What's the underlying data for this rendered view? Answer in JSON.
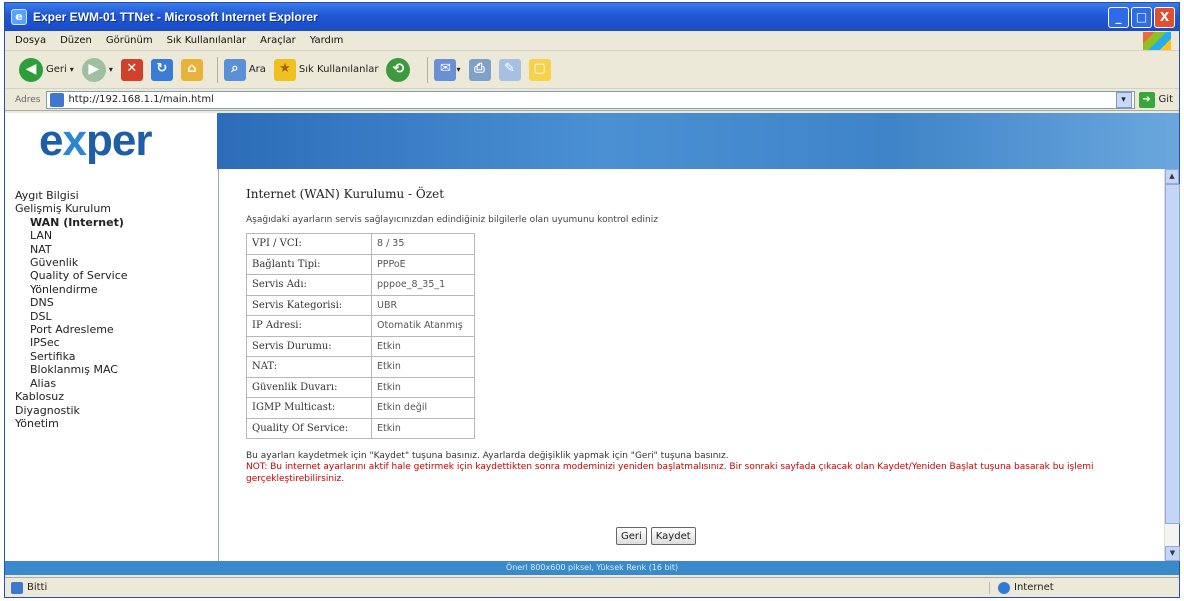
{
  "window": {
    "title": "Exper EWM-01 TTNet - Microsoft Internet Explorer",
    "buttons": [
      "_",
      "□",
      "X"
    ]
  },
  "menu": [
    "Dosya",
    "Düzen",
    "Görünüm",
    "Sık Kullanılanlar",
    "Araçlar",
    "Yardım"
  ],
  "toolbar": {
    "back_label": "Geri",
    "search_label": "Ara",
    "favorites_label": "Sık Kullanılanlar"
  },
  "address": {
    "label": "Adres",
    "url": "http://192.168.1.1/main.html",
    "go_label": "Git"
  },
  "brand": {
    "logo_pre": "e",
    "logo_x": "x",
    "logo_post": "per"
  },
  "sidebar": {
    "items": [
      {
        "label": "Aygıt Bilgisi",
        "level": 1
      },
      {
        "label": "Gelişmiş Kurulum",
        "level": 1
      },
      {
        "label": "WAN (Internet)",
        "level": 2
      },
      {
        "label": "LAN",
        "level": 2
      },
      {
        "label": "NAT",
        "level": 2
      },
      {
        "label": "Güvenlik",
        "level": 2
      },
      {
        "label": "Quality of Service",
        "level": 2
      },
      {
        "label": "Yönlendirme",
        "level": 2
      },
      {
        "label": "DNS",
        "level": 2
      },
      {
        "label": "DSL",
        "level": 2
      },
      {
        "label": "Port Adresleme",
        "level": 2
      },
      {
        "label": "IPSec",
        "level": 2
      },
      {
        "label": "Sertifika",
        "level": 2
      },
      {
        "label": "Bloklanmış MAC",
        "level": 2
      },
      {
        "label": "Alias",
        "level": 2
      },
      {
        "label": "Kablosuz",
        "level": 1
      },
      {
        "label": "Diyagnostik",
        "level": 1
      },
      {
        "label": "Yönetim",
        "level": 1
      }
    ]
  },
  "main": {
    "heading": "Internet (WAN) Kurulumu - Özet",
    "description": "Aşağıdaki ayarların servis sağlayıcınızdan edindiğiniz bilgilerle olan uyumunu kontrol ediniz",
    "summary": [
      {
        "key": "VPI / VCI:",
        "value": "8 / 35"
      },
      {
        "key": "Bağlantı Tipi:",
        "value": "PPPoE"
      },
      {
        "key": "Servis Adı:",
        "value": "pppoe_8_35_1"
      },
      {
        "key": "Servis Kategorisi:",
        "value": "UBR"
      },
      {
        "key": "IP Adresi:",
        "value": "Otomatik Atanmış"
      },
      {
        "key": "Servis Durumu:",
        "value": "Etkin"
      },
      {
        "key": "NAT:",
        "value": "Etkin"
      },
      {
        "key": "Güvenlik Duvarı:",
        "value": "Etkin"
      },
      {
        "key": "IGMP Multicast:",
        "value": "Etkin değil"
      },
      {
        "key": "Quality Of Service:",
        "value": "Etkin"
      }
    ],
    "note_save": "Bu ayarları kaydetmek için \"Kaydet\" tuşuna basınız. Ayarlarda değişiklik yapmak için \"Geri\" tuşuna basınız.",
    "note_warning": "NOT: Bu internet ayarlarını aktif hale getirmek için kaydettikten sonra modeminizi yeniden başlatmalısınız. Bir sonraki sayfada çıkacak olan Kaydet/Yeniden Başlat tuşuna basarak bu işlemi gerçekleştirebilirsiniz.",
    "back_button": "Geri",
    "save_button": "Kaydet"
  },
  "footer": "Önerl 800x600 piksel, Yüksek Renk (16 bit)",
  "statusbar": {
    "left": "Bitti",
    "zone": "Internet"
  }
}
